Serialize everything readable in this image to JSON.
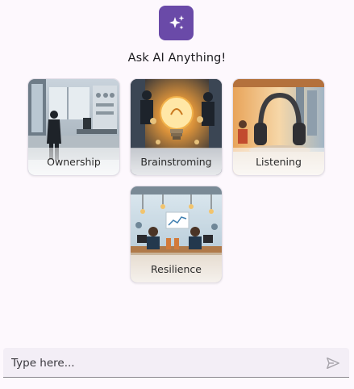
{
  "header": {
    "logo_icon": "sparkles-icon",
    "title": "Ask AI Anything!"
  },
  "topics": [
    {
      "label": "Ownership",
      "image": "office-man-at-window"
    },
    {
      "label": "Brainstroming",
      "image": "lightbulb-meeting"
    },
    {
      "label": "Listening",
      "image": "headphones-on-desk"
    },
    {
      "label": "Resilience",
      "image": "people-working-at-laptops"
    }
  ],
  "composer": {
    "placeholder": "Type here...",
    "value": "",
    "send_icon": "send-icon"
  },
  "colors": {
    "background": "#fdf8fd",
    "brand": "#6a4aa8",
    "input_background": "#f3eef6"
  }
}
